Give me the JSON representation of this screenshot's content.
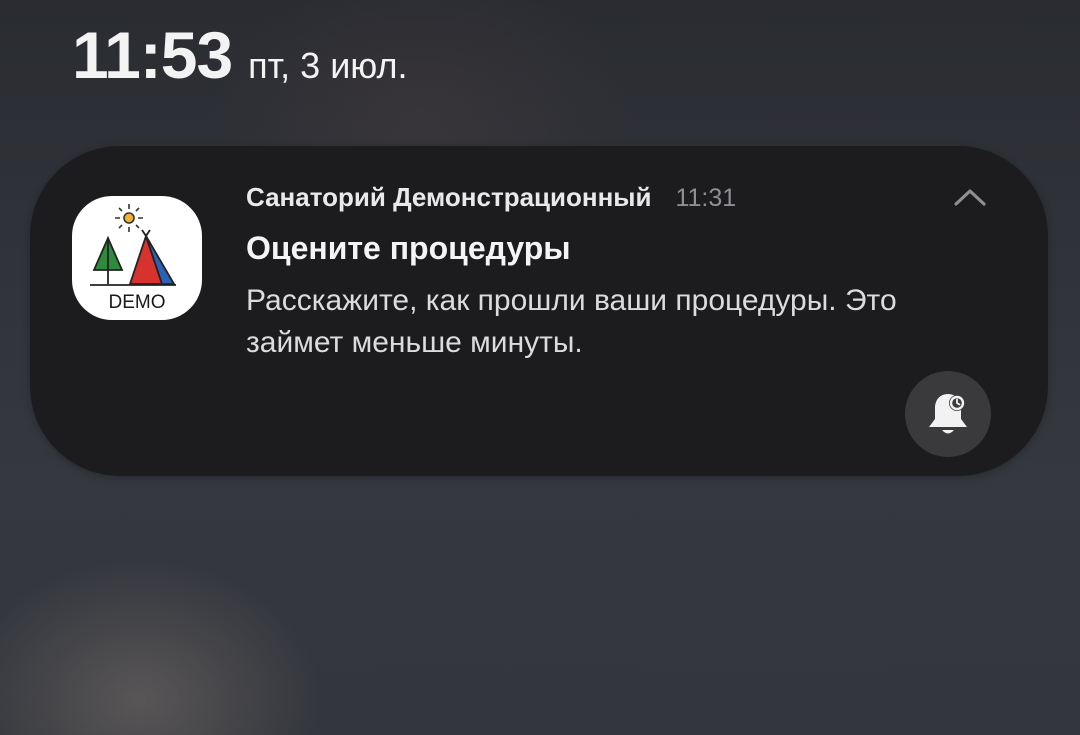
{
  "lockscreen": {
    "time": "11:53",
    "date": "пт, 3 июл."
  },
  "notification": {
    "app_name": "Санаторий Демонстрационный",
    "time": "11:31",
    "title": "Оцените процедуры",
    "body": "Расскажите, как прошли ваши процедуры. Это займет меньше минуты.",
    "app_icon": {
      "name": "sanatorium-logo-icon",
      "text": "DEMO"
    },
    "collapse_icon": "chevron-up-icon",
    "snooze_icon": "bell-snooze-icon"
  },
  "colors": {
    "card_background": "#1c1c1e",
    "tree_green": "#2e8b3d",
    "tent_red": "#d8322e",
    "tent_blue": "#2c62b4",
    "sun_yellow": "#f2b233"
  }
}
